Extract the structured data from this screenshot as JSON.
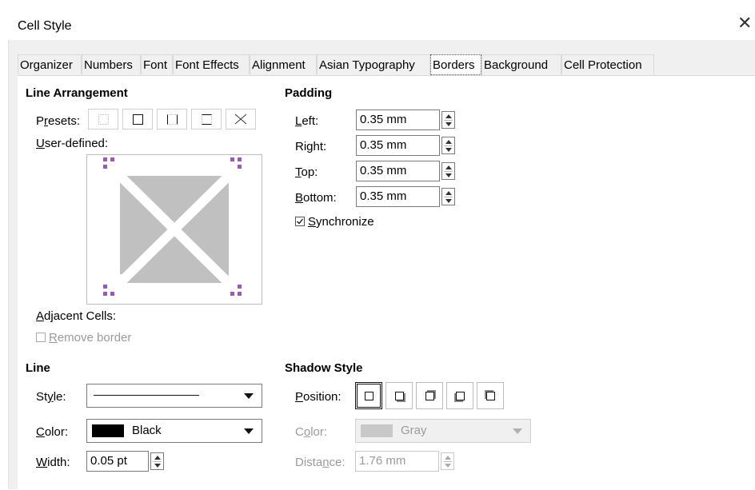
{
  "window": {
    "title": "Cell Style",
    "close_glyph": "✕"
  },
  "tabs": [
    {
      "label": "Organizer"
    },
    {
      "label": "Numbers"
    },
    {
      "label": "Font"
    },
    {
      "label": "Font Effects"
    },
    {
      "label": "Alignment"
    },
    {
      "label": "Asian Typography"
    },
    {
      "label": "Borders",
      "active": true
    },
    {
      "label": "Background"
    },
    {
      "label": "Cell Protection"
    }
  ],
  "line_arrangement": {
    "heading": "Line Arrangement",
    "presets_label": "Presets:",
    "user_defined_label": "User-defined:",
    "adjacent_label": "Adjacent Cells:",
    "remove_border_label": "Remove border"
  },
  "padding": {
    "heading": "Padding",
    "left_label": "Left:",
    "left_value": "0.35 mm",
    "right_label": "Right:",
    "right_value": "0.35 mm",
    "top_label": "Top:",
    "top_value": "0.35 mm",
    "bottom_label": "Bottom:",
    "bottom_value": "0.35 mm",
    "synchronize_label": "Synchronize",
    "synchronize_checked": true
  },
  "line": {
    "heading": "Line",
    "style_label": "Style:",
    "color_label": "Color:",
    "color_value": "Black",
    "color_hex": "#000000",
    "width_label": "Width:",
    "width_value": "0.05 pt"
  },
  "shadow": {
    "heading": "Shadow Style",
    "position_label": "Position:",
    "color_label": "Color:",
    "color_value": "Gray",
    "color_hex": "#c8c8c8",
    "distance_label": "Distance:",
    "distance_value": "1.76 mm"
  },
  "colors": {
    "accent_handle": "#9b59b6",
    "preview_gray": "#c0c0c0"
  }
}
